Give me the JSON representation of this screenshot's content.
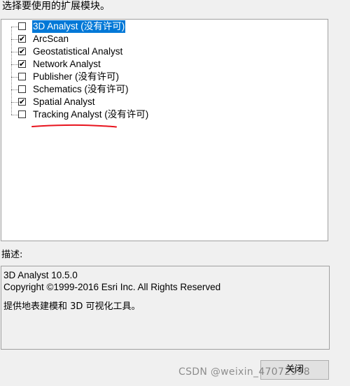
{
  "dialog": {
    "prompt": "选择要使用的扩展模块。",
    "extensions": [
      {
        "label": "3D Analyst (没有许可)",
        "checked": false,
        "selected": true
      },
      {
        "label": "ArcScan",
        "checked": true,
        "selected": false
      },
      {
        "label": "Geostatistical Analyst",
        "checked": true,
        "selected": false
      },
      {
        "label": "Network Analyst",
        "checked": true,
        "selected": false
      },
      {
        "label": "Publisher (没有许可)",
        "checked": false,
        "selected": false
      },
      {
        "label": "Schematics (没有许可)",
        "checked": false,
        "selected": false
      },
      {
        "label": "Spatial Analyst",
        "checked": true,
        "selected": false
      },
      {
        "label": "Tracking Analyst (没有许可)",
        "checked": false,
        "selected": false
      }
    ],
    "checkmark_glyph": "✔",
    "description_label": "描述:",
    "description": {
      "line1": "3D Analyst 10.5.0",
      "line2": "Copyright ©1999-2016 Esri Inc. All Rights Reserved",
      "line3": "提供地表建模和 3D 可视化工具。"
    },
    "close_label": "关闭",
    "annotation_color": "#e8141e",
    "selection_color": "#0078d7"
  },
  "watermark": "CSDN @weixin_47072998"
}
